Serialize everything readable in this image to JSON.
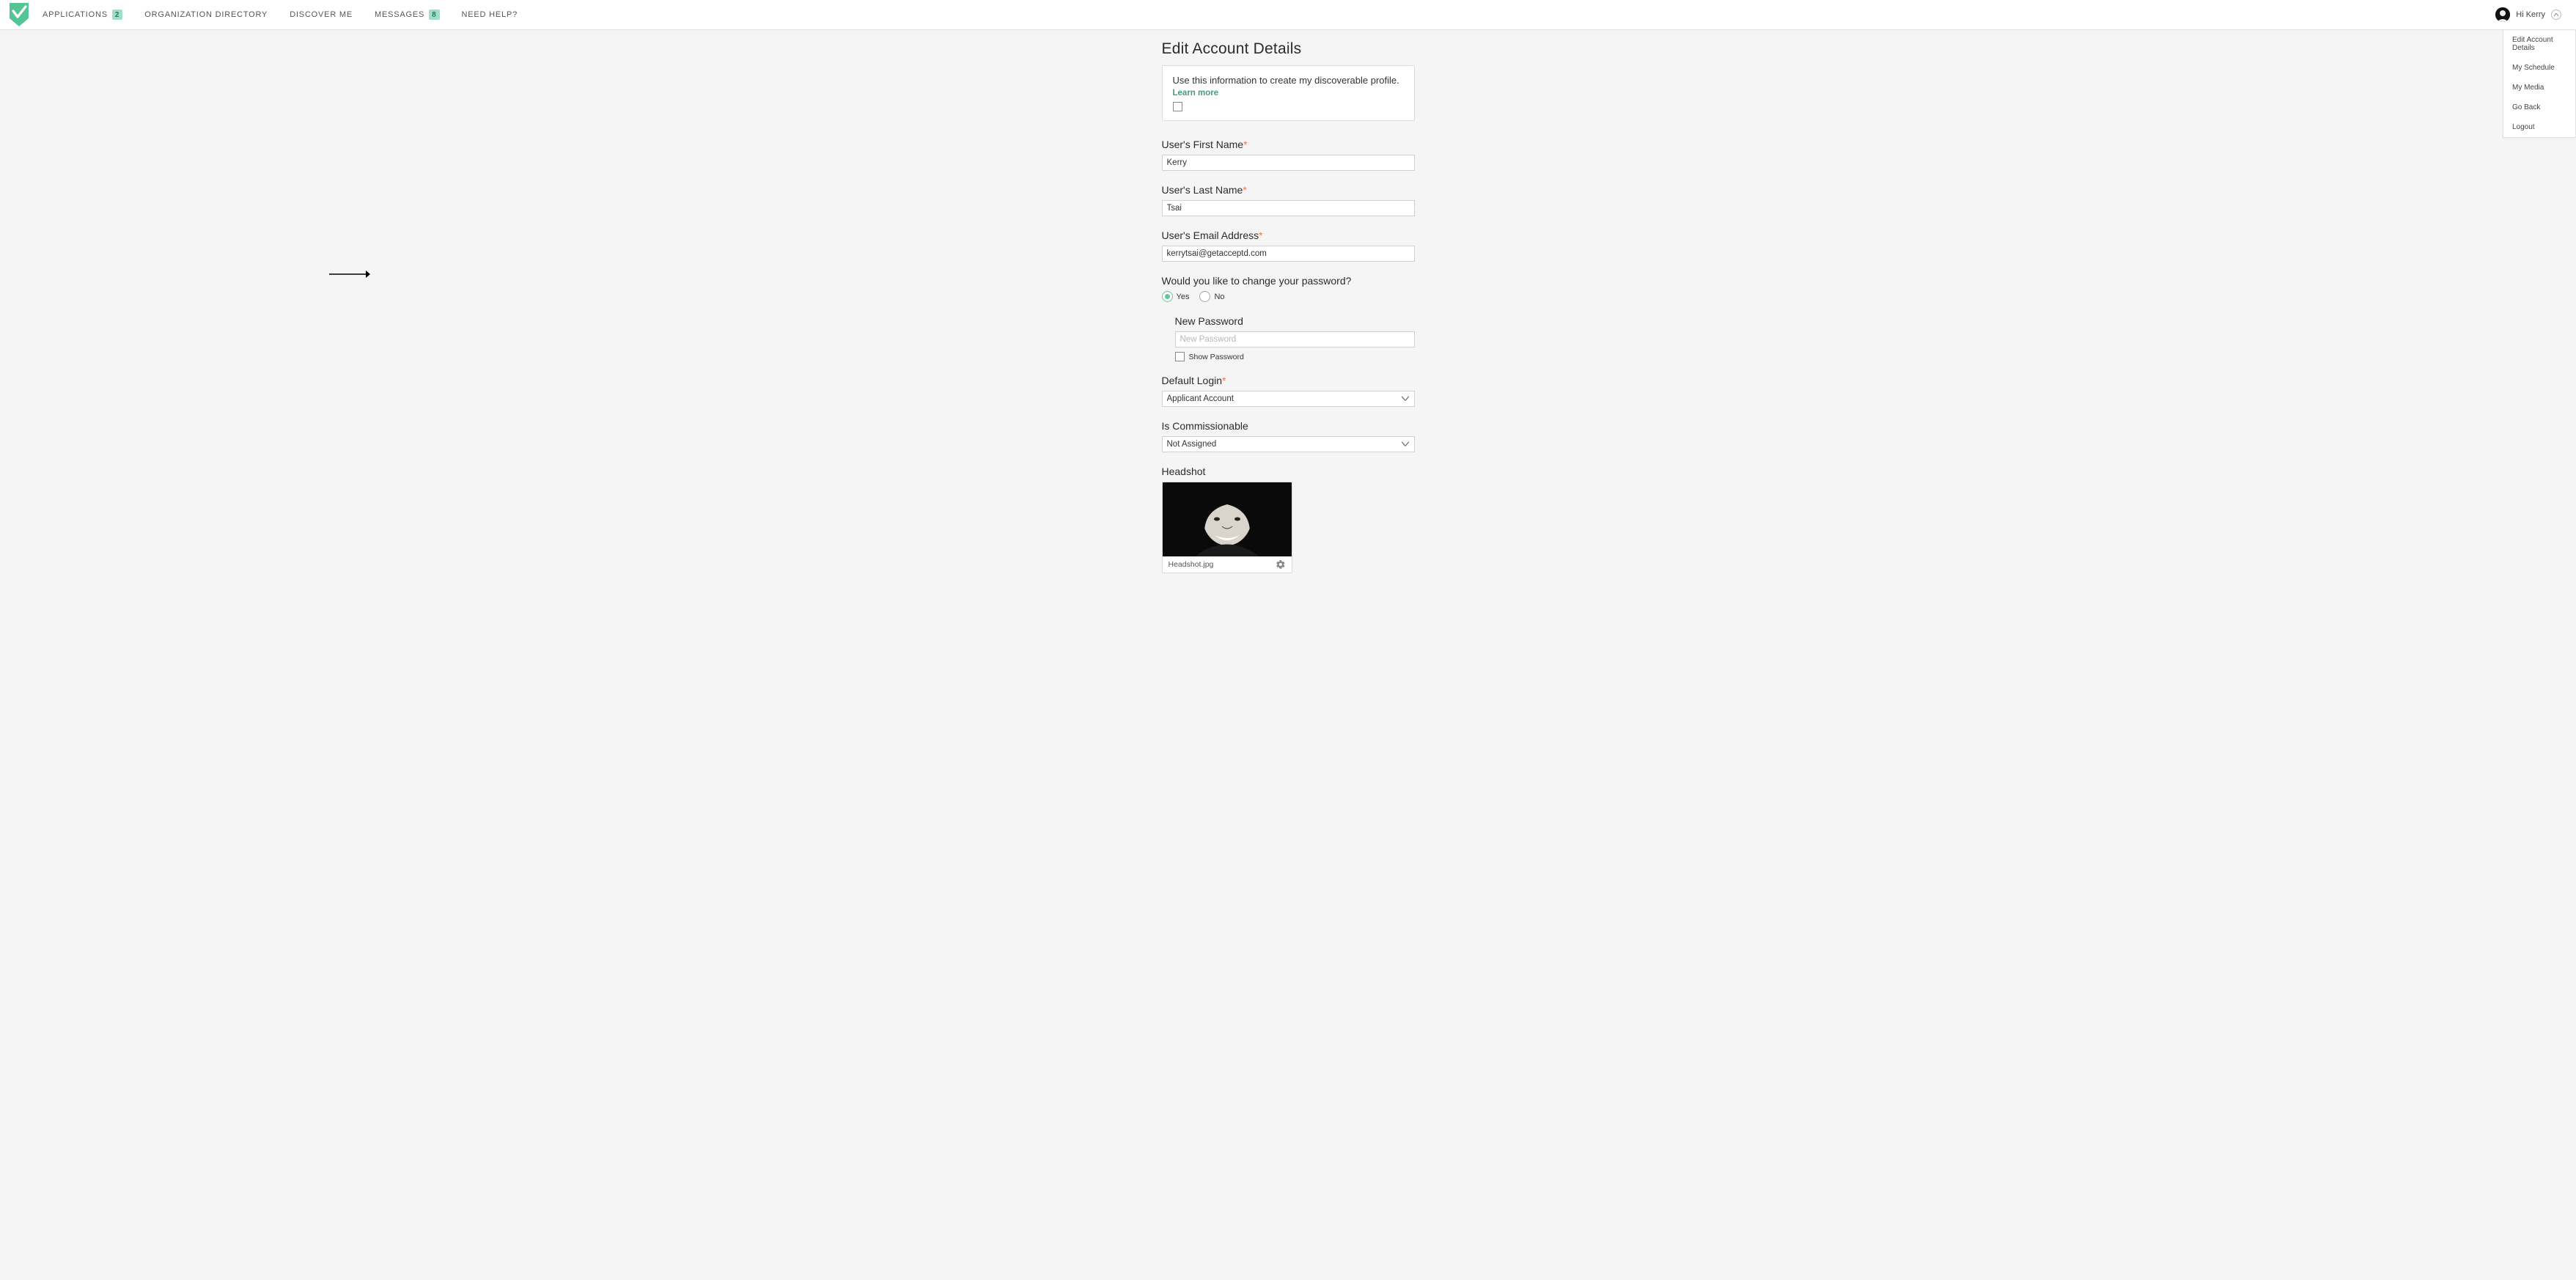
{
  "nav": {
    "applications": {
      "label": "APPLICATIONS",
      "badge": "2"
    },
    "org_directory": {
      "label": "ORGANIZATION DIRECTORY"
    },
    "discover_me": {
      "label": "DISCOVER ME"
    },
    "messages": {
      "label": "MESSAGES",
      "badge": "8"
    },
    "need_help": {
      "label": "NEED HELP?"
    },
    "greeting": "Hi Kerry"
  },
  "user_menu": {
    "items": [
      "Edit Account Details",
      "My Schedule",
      "My Media",
      "Go Back",
      "Logout"
    ]
  },
  "page": {
    "title": "Edit Account Details",
    "info_text": "Use this information to create my discoverable profile.",
    "info_link": "Learn more"
  },
  "fields": {
    "first_name": {
      "label": "User's First Name",
      "value": "Kerry"
    },
    "last_name": {
      "label": "User's Last Name",
      "value": "Tsai"
    },
    "email": {
      "label": "User's Email Address",
      "value": "kerrytsai@getacceptd.com"
    },
    "change_pw": {
      "label": "Would you like to change your password?",
      "yes": "Yes",
      "no": "No"
    },
    "new_pw": {
      "label": "New Password",
      "placeholder": "New Password",
      "show_label": "Show Password"
    },
    "default_login": {
      "label": "Default Login",
      "value": "Applicant Account"
    },
    "commissionable": {
      "label": "Is Commissionable",
      "value": "Not Assigned"
    },
    "headshot": {
      "label": "Headshot",
      "filename": "Headshot.jpg"
    }
  }
}
